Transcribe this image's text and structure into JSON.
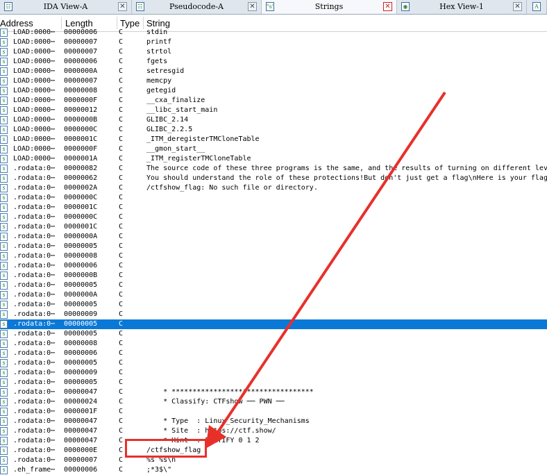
{
  "tabs": [
    {
      "label": "IDA View-A",
      "icon": "ida-view-icon",
      "active": false
    },
    {
      "label": "Pseudocode-A",
      "icon": "pseudocode-icon",
      "active": false
    },
    {
      "label": "Strings",
      "icon": "strings-icon",
      "active": true
    },
    {
      "label": "Hex View-1",
      "icon": "hex-view-icon",
      "active": false
    }
  ],
  "columns": {
    "address": "Address",
    "length": "Length",
    "type": "Type",
    "string": "String"
  },
  "rows": [
    {
      "address": "LOAD:0000⋯",
      "length": "00000006",
      "type": "C",
      "string": "stdin"
    },
    {
      "address": "LOAD:0000⋯",
      "length": "00000007",
      "type": "C",
      "string": "printf"
    },
    {
      "address": "LOAD:0000⋯",
      "length": "00000007",
      "type": "C",
      "string": "strtol"
    },
    {
      "address": "LOAD:0000⋯",
      "length": "00000006",
      "type": "C",
      "string": "fgets"
    },
    {
      "address": "LOAD:0000⋯",
      "length": "0000000A",
      "type": "C",
      "string": "setresgid"
    },
    {
      "address": "LOAD:0000⋯",
      "length": "00000007",
      "type": "C",
      "string": "memcpy"
    },
    {
      "address": "LOAD:0000⋯",
      "length": "00000008",
      "type": "C",
      "string": "getegid"
    },
    {
      "address": "LOAD:0000⋯",
      "length": "0000000F",
      "type": "C",
      "string": "__cxa_finalize"
    },
    {
      "address": "LOAD:0000⋯",
      "length": "00000012",
      "type": "C",
      "string": "__libc_start_main"
    },
    {
      "address": "LOAD:0000⋯",
      "length": "0000000B",
      "type": "C",
      "string": "GLIBC_2.14"
    },
    {
      "address": "LOAD:0000⋯",
      "length": "0000000C",
      "type": "C",
      "string": "GLIBC_2.2.5"
    },
    {
      "address": "LOAD:0000⋯",
      "length": "0000001C",
      "type": "C",
      "string": "_ITM_deregisterTMCloneTable"
    },
    {
      "address": "LOAD:0000⋯",
      "length": "0000000F",
      "type": "C",
      "string": "__gmon_start__"
    },
    {
      "address": "LOAD:0000⋯",
      "length": "0000001A",
      "type": "C",
      "string": "_ITM_registerTMCloneTable"
    },
    {
      "address": ".rodata:0⋯",
      "length": "00000082",
      "type": "C",
      "string": "The source code of these three programs is the same, and the results of turning on different lev"
    },
    {
      "address": ".rodata:0⋯",
      "length": "00000062",
      "type": "C",
      "string": "You should understand the role of these protections!But don't just get a flag\\nHere is your flag"
    },
    {
      "address": ".rodata:0⋯",
      "length": "0000002A",
      "type": "C",
      "string": "/ctfshow_flag: No such file or directory."
    },
    {
      "address": ".rodata:0⋯",
      "length": "0000000C",
      "type": "C",
      "string": ""
    },
    {
      "address": ".rodata:0⋯",
      "length": "0000001C",
      "type": "C",
      "string": ""
    },
    {
      "address": ".rodata:0⋯",
      "length": "0000000C",
      "type": "C",
      "string": ""
    },
    {
      "address": ".rodata:0⋯",
      "length": "0000001C",
      "type": "C",
      "string": ""
    },
    {
      "address": ".rodata:0⋯",
      "length": "0000000A",
      "type": "C",
      "string": ""
    },
    {
      "address": ".rodata:0⋯",
      "length": "00000005",
      "type": "C",
      "string": ""
    },
    {
      "address": ".rodata:0⋯",
      "length": "00000008",
      "type": "C",
      "string": ""
    },
    {
      "address": ".rodata:0⋯",
      "length": "00000006",
      "type": "C",
      "string": ""
    },
    {
      "address": ".rodata:0⋯",
      "length": "0000000B",
      "type": "C",
      "string": ""
    },
    {
      "address": ".rodata:0⋯",
      "length": "00000005",
      "type": "C",
      "string": ""
    },
    {
      "address": ".rodata:0⋯",
      "length": "0000000A",
      "type": "C",
      "string": ""
    },
    {
      "address": ".rodata:0⋯",
      "length": "00000005",
      "type": "C",
      "string": ""
    },
    {
      "address": ".rodata:0⋯",
      "length": "00000009",
      "type": "C",
      "string": ""
    },
    {
      "address": ".rodata:0⋯",
      "length": "00000005",
      "type": "C",
      "string": "",
      "selected": true
    },
    {
      "address": ".rodata:0⋯",
      "length": "00000005",
      "type": "C",
      "string": ""
    },
    {
      "address": ".rodata:0⋯",
      "length": "00000008",
      "type": "C",
      "string": ""
    },
    {
      "address": ".rodata:0⋯",
      "length": "00000006",
      "type": "C",
      "string": ""
    },
    {
      "address": ".rodata:0⋯",
      "length": "00000005",
      "type": "C",
      "string": ""
    },
    {
      "address": ".rodata:0⋯",
      "length": "00000009",
      "type": "C",
      "string": ""
    },
    {
      "address": ".rodata:0⋯",
      "length": "00000005",
      "type": "C",
      "string": ""
    },
    {
      "address": ".rodata:0⋯",
      "length": "00000047",
      "type": "C",
      "string": "    * **********************************"
    },
    {
      "address": ".rodata:0⋯",
      "length": "00000024",
      "type": "C",
      "string": "    * Classify: CTFshow ── PWN ──"
    },
    {
      "address": ".rodata:0⋯",
      "length": "0000001F",
      "type": "C",
      "string": ""
    },
    {
      "address": ".rodata:0⋯",
      "length": "00000047",
      "type": "C",
      "string": "    * Type  : Linux_Security_Mechanisms"
    },
    {
      "address": ".rodata:0⋯",
      "length": "00000047",
      "type": "C",
      "string": "    * Site  : https://ctf.show/"
    },
    {
      "address": ".rodata:0⋯",
      "length": "00000047",
      "type": "C",
      "string": "    * Hint  : FORTIFY 0 1 2"
    },
    {
      "address": ".rodata:0⋯",
      "length": "0000000E",
      "type": "C",
      "string": "/ctfshow_flag"
    },
    {
      "address": ".rodata:0⋯",
      "length": "00000007",
      "type": "C",
      "string": "%s %s\\n"
    },
    {
      "address": ".eh_frame⋯",
      "length": "00000006",
      "type": "C",
      "string": ";*3$\\\""
    }
  ],
  "colors": {
    "selection": "#0a78d7",
    "annotation": "#e8302a",
    "icon_green": "#2a8a2a"
  }
}
